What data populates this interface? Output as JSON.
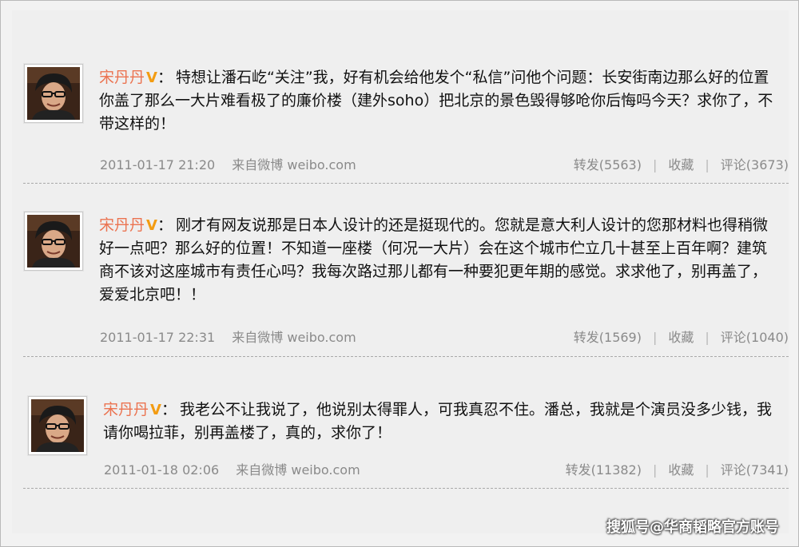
{
  "posts": [
    {
      "username": "宋丹丹",
      "badge": "V",
      "text": "特想让潘石屹“关注”我，好有机会给他发个“私信”问他个问题：长安街南边那么好的位置你盖了那么一大片难看极了的廉价楼（建外soho）把北京的景色毁得够呛你后悔吗今天？求你了，不带这样的！",
      "time": "2011-01-17 21:20",
      "source": "来自微博 weibo.com",
      "repost": "转发(5563)",
      "favorite": "收藏",
      "comment": "评论(3673)"
    },
    {
      "username": "宋丹丹",
      "badge": "V",
      "text": "刚才有网友说那是日本人设计的还是挺现代的。您就是意大利人设计的您那材料也得稍微好一点吧？那么好的位置！不知道一座楼（何况一大片）会在这个城市伫立几十甚至上百年啊？建筑商不该对这座城市有责任心吗？我每次路过那儿都有一种要犯更年期的感觉。求求他了，别再盖了，爱爱北京吧！！",
      "time": "2011-01-17 22:31",
      "source": "来自微博 weibo.com",
      "repost": "转发(1569)",
      "favorite": "收藏",
      "comment": "评论(1040)"
    },
    {
      "username": "宋丹丹",
      "badge": "V",
      "text": "我老公不让我说了，他说别太得罪人，可我真忍不住。潘总，我就是个演员没多少钱，我请你喝拉菲，别再盖楼了，真的，求你了！",
      "time": "2011-01-18 02:06",
      "source": "来自微博 weibo.com",
      "repost": "转发(11382)",
      "favorite": "收藏",
      "comment": "评论(7341)"
    }
  ],
  "watermark": "搜狐号@华商韬略官方账号"
}
